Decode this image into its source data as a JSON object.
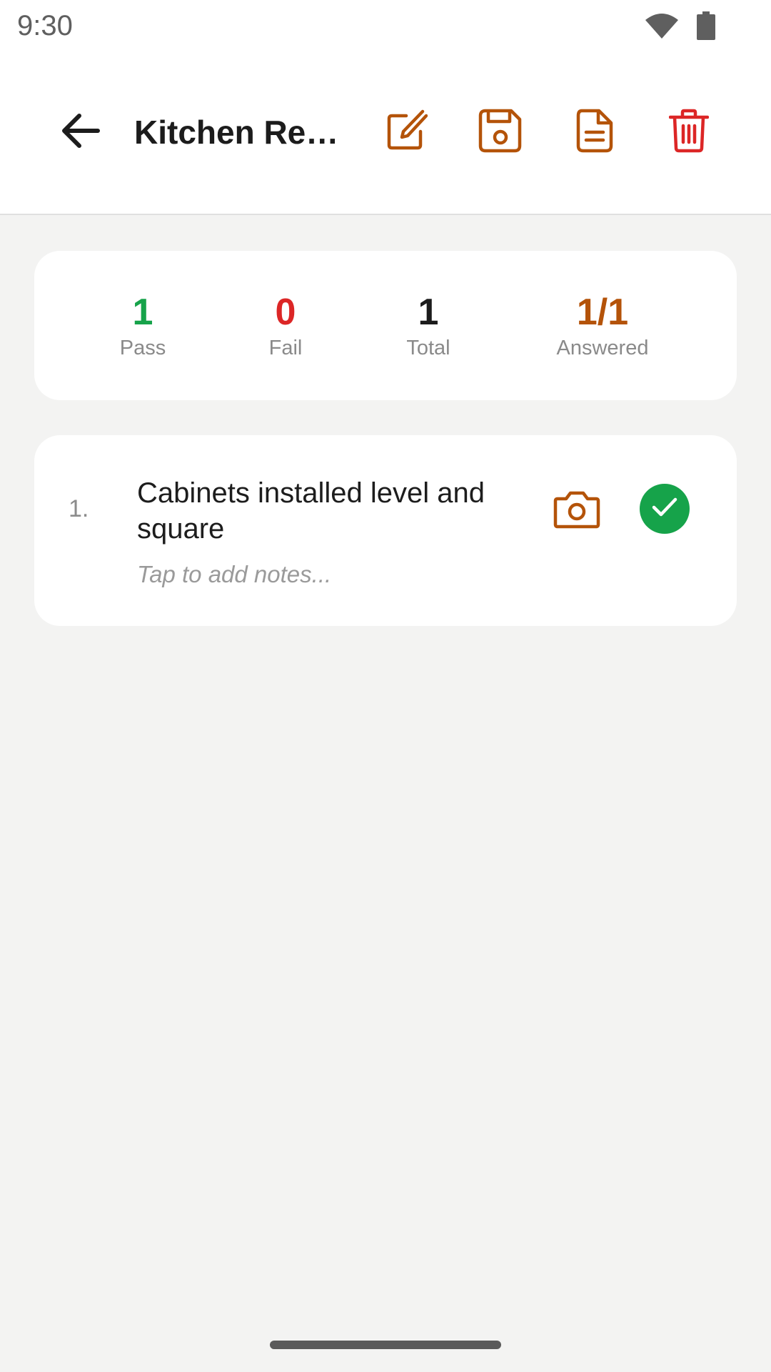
{
  "status_bar": {
    "time": "9:30",
    "icons": [
      "wifi-icon",
      "battery-icon"
    ]
  },
  "app_bar": {
    "title": "Kitchen Remodel Inspection",
    "actions": [
      "edit-icon",
      "save-icon",
      "document-icon",
      "trash-icon"
    ]
  },
  "colors": {
    "accent": "#b45309",
    "pass": "#16a34a",
    "fail": "#dc2626",
    "delete": "#dc2626",
    "background": "#f3f3f2"
  },
  "summary": {
    "pass_value": "1",
    "pass_label": "Pass",
    "fail_value": "0",
    "fail_label": "Fail",
    "total_value": "1",
    "total_label": "Total",
    "answered_value": "1/1",
    "answered_label": "Answered"
  },
  "items": [
    {
      "number": "1.",
      "text": "Cabinets installed level and square",
      "notes_placeholder": "Tap to add notes...",
      "status": "pass"
    }
  ]
}
